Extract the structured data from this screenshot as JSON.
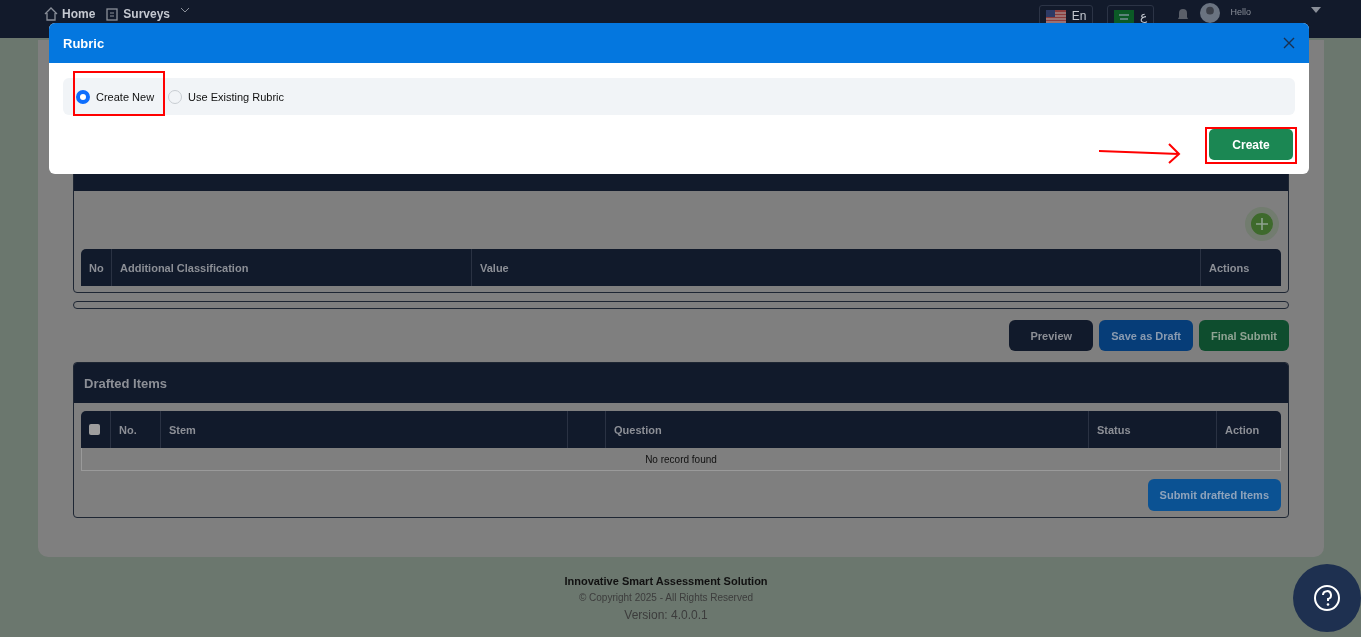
{
  "nav": {
    "items": [
      {
        "label": "Home",
        "kind": "home"
      },
      {
        "label": "Surveys",
        "kind": "surveys"
      }
    ],
    "languages": [
      {
        "label": "En",
        "kind": "us"
      },
      {
        "label": "ع",
        "kind": "sa"
      }
    ],
    "greeting": "Hello"
  },
  "modal": {
    "title": "Rubric",
    "options": [
      {
        "label": "Create New",
        "selected": true
      },
      {
        "label": "Use Existing Rubric",
        "selected": false
      }
    ],
    "button": "Create"
  },
  "classification_table": {
    "columns": [
      "No",
      "Additional Classification",
      "Value",
      "Actions"
    ]
  },
  "actions": [
    {
      "label": "Preview",
      "kind": "dark"
    },
    {
      "label": "Save as Draft",
      "kind": "blue"
    },
    {
      "label": "Final Submit",
      "kind": "green"
    }
  ],
  "drafted": {
    "title": "Drafted Items",
    "select_all": {
      "checked": false
    },
    "columns": [
      "No.",
      "Stem",
      "",
      "Question",
      "Status",
      "Action"
    ],
    "empty": "No record found",
    "button": "Submit drafted Items"
  },
  "footer": {
    "title": "Innovative Smart Assessment Solution",
    "copyright": "© Copyright 2025 - All Rights Reserved",
    "version": "Version: 4.0.0.1"
  }
}
